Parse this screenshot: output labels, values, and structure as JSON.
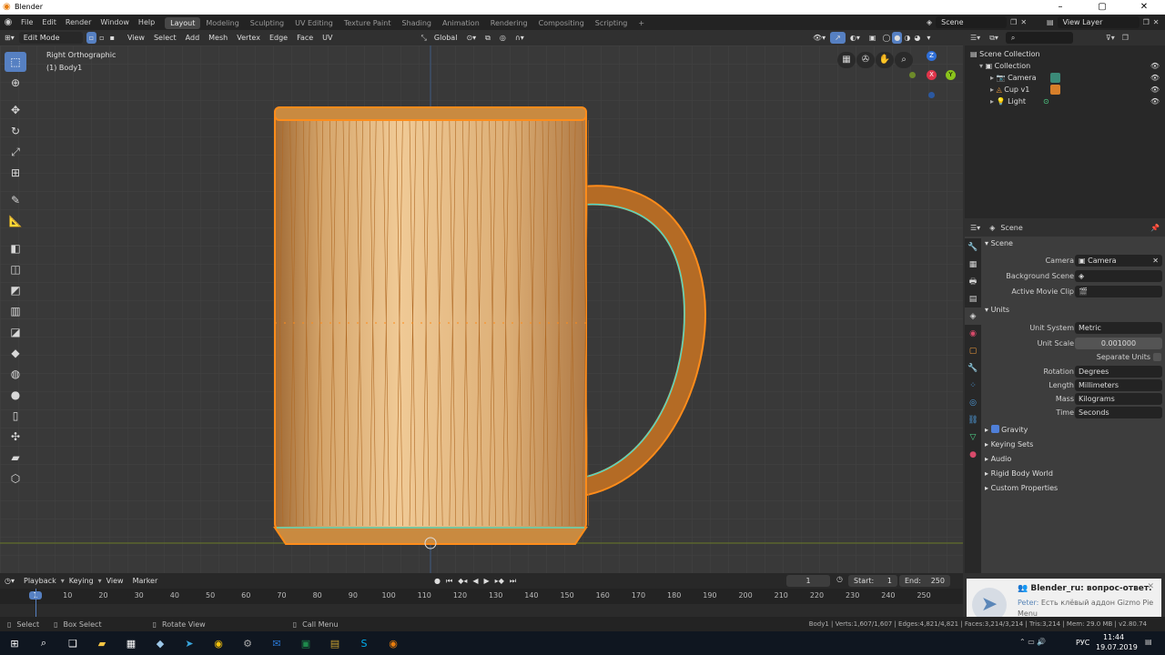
{
  "window": {
    "title": "Blender",
    "min": "–",
    "max": "▢",
    "close": "✕"
  },
  "menu": [
    "File",
    "Edit",
    "Render",
    "Window",
    "Help"
  ],
  "workspaces": [
    "Layout",
    "Modeling",
    "Sculpting",
    "UV Editing",
    "Texture Paint",
    "Shading",
    "Animation",
    "Rendering",
    "Compositing",
    "Scripting"
  ],
  "workspace_add": "+",
  "scene_field": "Scene",
  "viewlayer_field": "View Layer",
  "vp_header": {
    "mode": "Edit Mode",
    "menus": [
      "View",
      "Select",
      "Add",
      "Mesh",
      "Vertex",
      "Edge",
      "Face",
      "UV"
    ],
    "orientation": "Global"
  },
  "viewport": {
    "view_name": "Right Orthographic",
    "object_name": "(1) Body1"
  },
  "gizmo": {
    "z": "Z",
    "x": "X",
    "y": "Y"
  },
  "outliner": {
    "search_placeholder": "",
    "root": "Scene Collection",
    "collection": "Collection",
    "items": [
      {
        "name": "Camera"
      },
      {
        "name": "Cup v1"
      },
      {
        "name": "Light"
      }
    ]
  },
  "properties": {
    "context": "Scene",
    "section_scene": "Scene",
    "camera_label": "Camera",
    "camera_value": "Camera",
    "bg_label": "Background Scene",
    "clip_label": "Active Movie Clip",
    "section_units": "Units",
    "unit_system_label": "Unit System",
    "unit_system": "Metric",
    "unit_scale_label": "Unit Scale",
    "unit_scale": "0.001000",
    "separate_units": "Separate Units",
    "rotation_label": "Rotation",
    "rotation": "Degrees",
    "length_label": "Length",
    "length": "Millimeters",
    "mass_label": "Mass",
    "mass": "Kilograms",
    "time_label": "Time",
    "time": "Seconds",
    "collapsed": [
      "Gravity",
      "Keying Sets",
      "Audio",
      "Rigid Body World",
      "Custom Properties"
    ]
  },
  "timeline": {
    "menus": [
      "Playback",
      "Keying",
      "View",
      "Marker"
    ],
    "current_frame": "1",
    "start_label": "Start:",
    "start": "1",
    "end_label": "End:",
    "end": "250",
    "ticks": [
      "1",
      "10",
      "20",
      "30",
      "40",
      "50",
      "60",
      "70",
      "80",
      "90",
      "100",
      "110",
      "120",
      "130",
      "140",
      "150",
      "160",
      "170",
      "180",
      "190",
      "200",
      "210",
      "220",
      "230",
      "240",
      "250"
    ]
  },
  "statusbar": {
    "select": "Select",
    "box_select": "Box Select",
    "rotate_view": "Rotate View",
    "call_menu": "Call Menu",
    "stats": "Body1 | Verts:1,607/1,607 | Edges:4,821/4,821 | Faces:3,214/3,214 | Tris:3,214 | Mem: 29.0 MB | v2.80.74"
  },
  "notification": {
    "title": "Blender_ru: вопрос-ответ.",
    "sender": "Peter:",
    "text": "Есть клёвый аддон Gizmo Pie Menu"
  },
  "taskbar": {
    "lang": "РУС",
    "time": "11:44",
    "date": "19.07.2019"
  },
  "colors": {
    "accent": "#5680c2",
    "mesh_edge": "#ff8c1a",
    "cup_fill": "#e6bf8a",
    "active_tab": "#474747"
  }
}
